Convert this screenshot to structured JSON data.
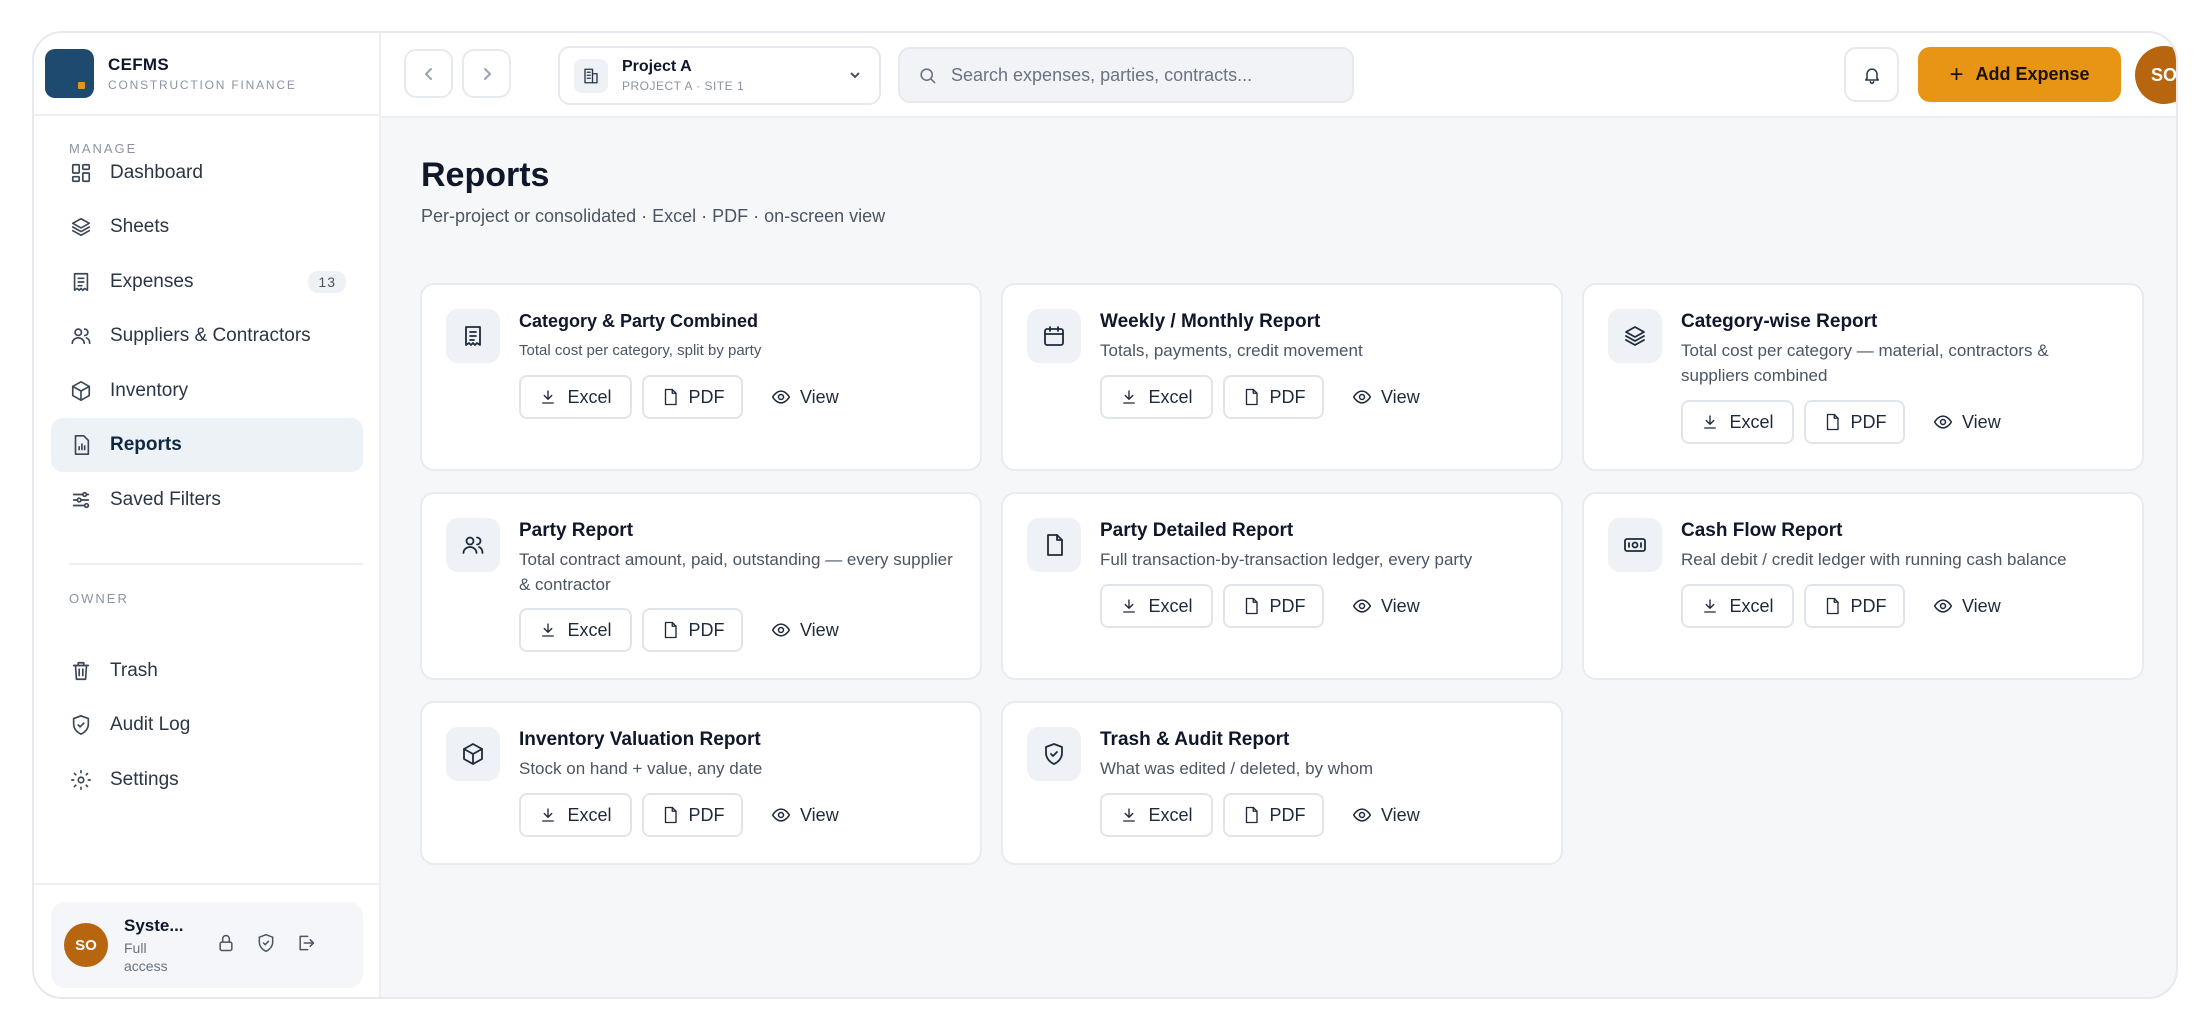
{
  "brand": {
    "name": "CEFMS",
    "subtitle": "CONSTRUCTION FINANCE"
  },
  "sidebar": {
    "section_manage": "MANAGE",
    "section_owner": "OWNER",
    "items": [
      {
        "label": "Dashboard",
        "icon": "dashboard-icon"
      },
      {
        "label": "Sheets",
        "icon": "layers-icon"
      },
      {
        "label": "Expenses",
        "icon": "receipt-icon",
        "badge": "13"
      },
      {
        "label": "Suppliers & Contractors",
        "icon": "users-icon"
      },
      {
        "label": "Inventory",
        "icon": "box-icon"
      },
      {
        "label": "Reports",
        "icon": "report-icon",
        "active": true
      },
      {
        "label": "Saved Filters",
        "icon": "sliders-icon"
      }
    ],
    "owner_items": [
      {
        "label": "Trash",
        "icon": "trash-icon"
      },
      {
        "label": "Audit Log",
        "icon": "shield-icon"
      },
      {
        "label": "Settings",
        "icon": "gear-icon"
      }
    ],
    "user": {
      "initials": "SO",
      "name": "Syste...",
      "role": "Full access"
    }
  },
  "topbar": {
    "project": {
      "name": "Project A",
      "site": "PROJECT A · SITE 1"
    },
    "search_placeholder": "Search expenses, parties, contracts...",
    "add_button_label": "Add Expense",
    "avatar_initials": "SO"
  },
  "page": {
    "title": "Reports",
    "subtitle": "Per-project or consolidated · Excel · PDF · on-screen view"
  },
  "actions": {
    "excel": "Excel",
    "pdf": "PDF",
    "view": "View"
  },
  "reports": [
    {
      "title": "Category & Party Combined",
      "desc": "Total cost per category, split by party",
      "icon": "receipt-icon"
    },
    {
      "title": "Weekly / Monthly Report",
      "desc": "Totals, payments, credit movement",
      "icon": "calendar-icon"
    },
    {
      "title": "Category-wise Report",
      "desc": "Total cost per category — material, contractors & suppliers combined",
      "icon": "layers-icon"
    },
    {
      "title": "Party Report",
      "desc": "Total contract amount, paid, outstanding — every supplier & contractor",
      "icon": "users-icon"
    },
    {
      "title": "Party Detailed Report",
      "desc": "Full transaction-by-transaction ledger, every party",
      "icon": "file-icon"
    },
    {
      "title": "Cash Flow Report",
      "desc": "Real debit / credit ledger with running cash balance",
      "icon": "cash-icon"
    },
    {
      "title": "Inventory Valuation Report",
      "desc": "Stock on hand + value, any date",
      "icon": "box-icon"
    },
    {
      "title": "Trash & Audit Report",
      "desc": "What was edited / deleted, by whom",
      "icon": "shield-check-icon"
    }
  ],
  "colors": {
    "accent": "#e89516",
    "brand": "#1d4a6e",
    "avatar": "#b7650e"
  }
}
